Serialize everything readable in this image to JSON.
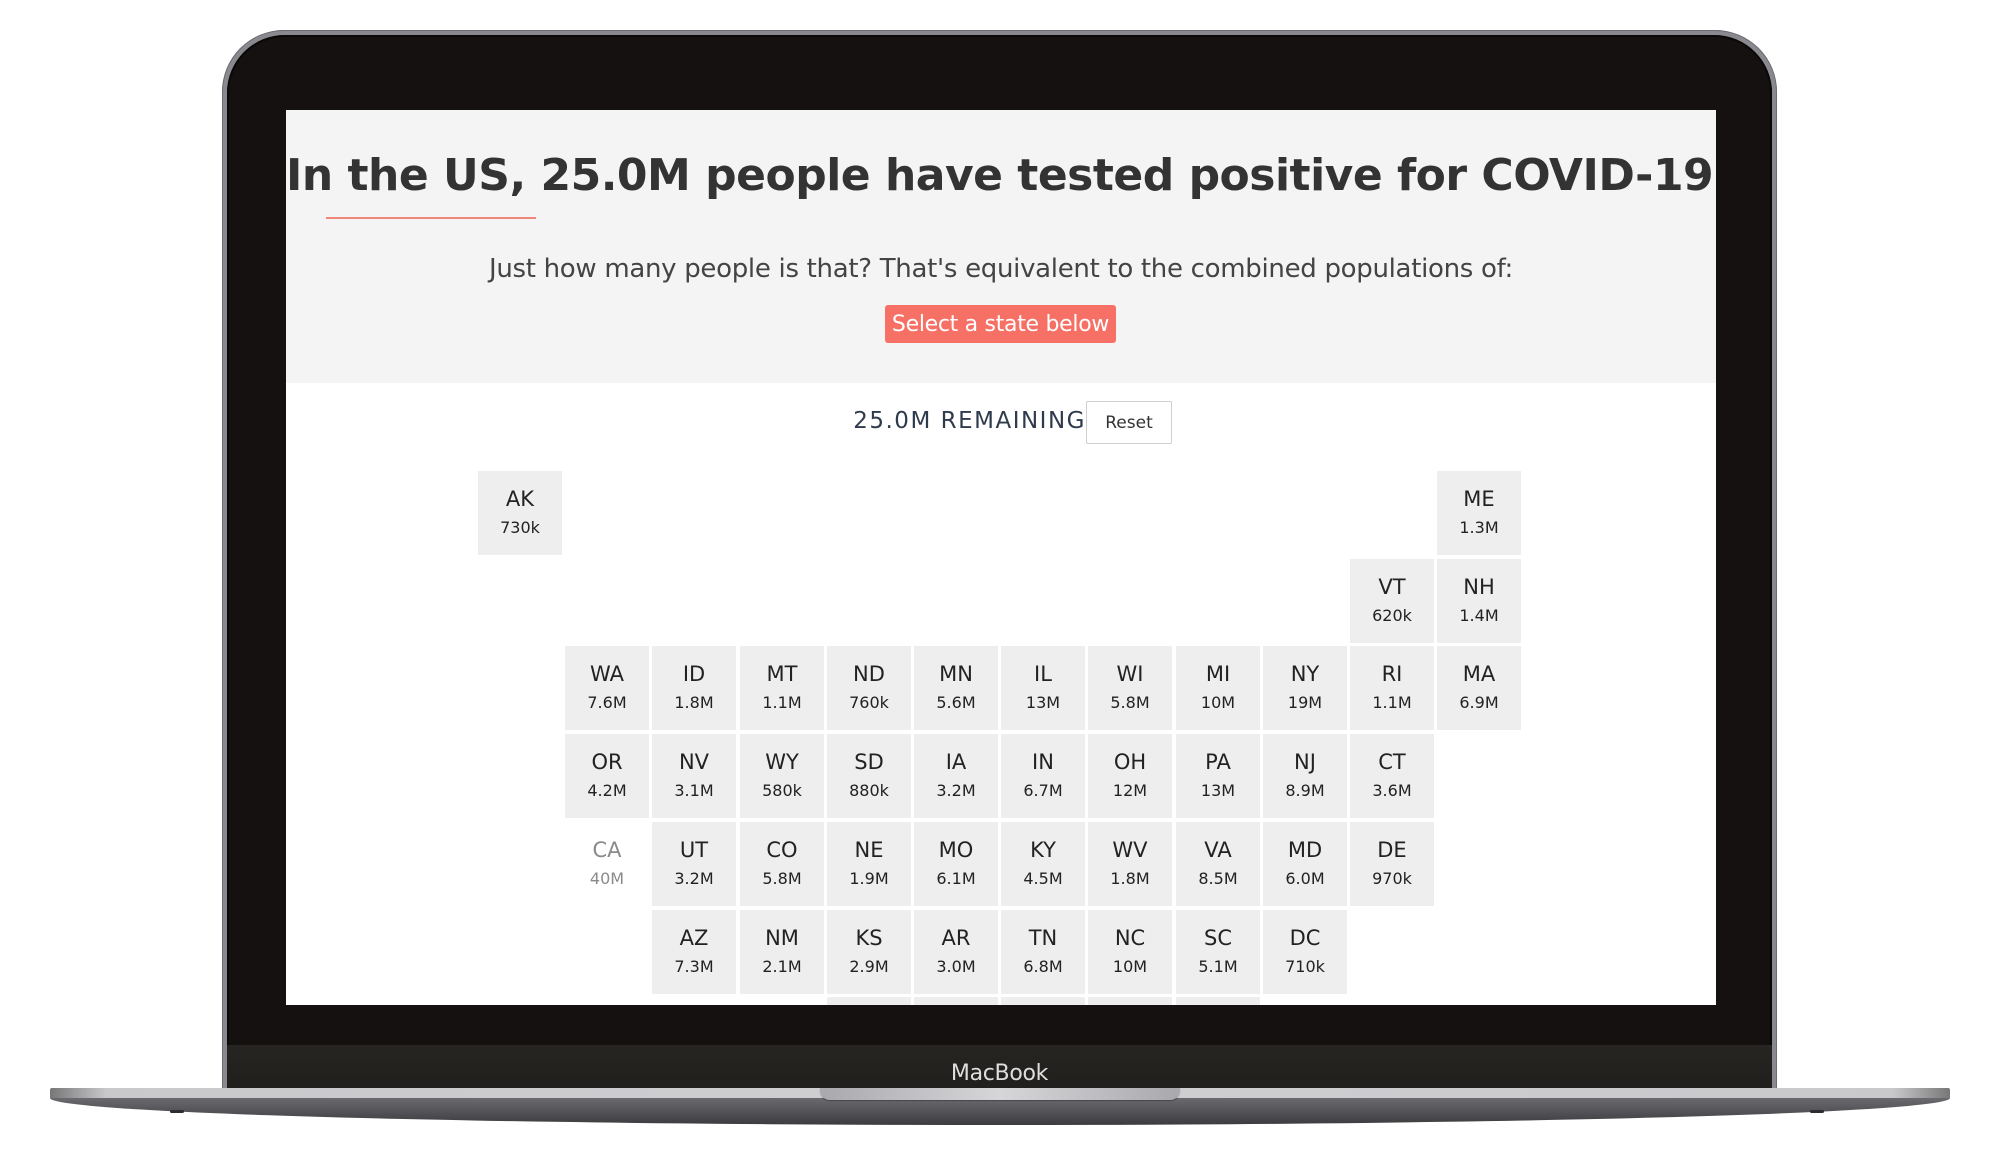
{
  "device": {
    "brand_label": "MacBook"
  },
  "hero": {
    "title": "In the US, 25.0M people have tested positive for COVID-19.",
    "subtitle": "Just how many people is that? That's equivalent to the combined populations of:",
    "cta_label": "Select a state below"
  },
  "controls": {
    "remaining_text": "25.0M REMAINING",
    "reset_label": "Reset"
  },
  "colors": {
    "accent": "#f67066",
    "underline": "#f0857a",
    "tile_bg": "#eeeeee",
    "hero_bg": "#f4f4f4",
    "remaining_text": "#2f3b4d"
  },
  "states": [
    {
      "abbr": "AK",
      "pop": "730k",
      "row": 0,
      "col": 0,
      "enabled": true
    },
    {
      "abbr": "ME",
      "pop": "1.3M",
      "row": 0,
      "col": 11,
      "enabled": true
    },
    {
      "abbr": "VT",
      "pop": "620k",
      "row": 1,
      "col": 10,
      "enabled": true
    },
    {
      "abbr": "NH",
      "pop": "1.4M",
      "row": 1,
      "col": 11,
      "enabled": true
    },
    {
      "abbr": "WA",
      "pop": "7.6M",
      "row": 2,
      "col": 1,
      "enabled": true
    },
    {
      "abbr": "ID",
      "pop": "1.8M",
      "row": 2,
      "col": 2,
      "enabled": true
    },
    {
      "abbr": "MT",
      "pop": "1.1M",
      "row": 2,
      "col": 3,
      "enabled": true
    },
    {
      "abbr": "ND",
      "pop": "760k",
      "row": 2,
      "col": 4,
      "enabled": true
    },
    {
      "abbr": "MN",
      "pop": "5.6M",
      "row": 2,
      "col": 5,
      "enabled": true
    },
    {
      "abbr": "IL",
      "pop": "13M",
      "row": 2,
      "col": 6,
      "enabled": true
    },
    {
      "abbr": "WI",
      "pop": "5.8M",
      "row": 2,
      "col": 7,
      "enabled": true
    },
    {
      "abbr": "MI",
      "pop": "10M",
      "row": 2,
      "col": 8,
      "enabled": true
    },
    {
      "abbr": "NY",
      "pop": "19M",
      "row": 2,
      "col": 9,
      "enabled": true
    },
    {
      "abbr": "RI",
      "pop": "1.1M",
      "row": 2,
      "col": 10,
      "enabled": true
    },
    {
      "abbr": "MA",
      "pop": "6.9M",
      "row": 2,
      "col": 11,
      "enabled": true
    },
    {
      "abbr": "OR",
      "pop": "4.2M",
      "row": 3,
      "col": 1,
      "enabled": true
    },
    {
      "abbr": "NV",
      "pop": "3.1M",
      "row": 3,
      "col": 2,
      "enabled": true
    },
    {
      "abbr": "WY",
      "pop": "580k",
      "row": 3,
      "col": 3,
      "enabled": true
    },
    {
      "abbr": "SD",
      "pop": "880k",
      "row": 3,
      "col": 4,
      "enabled": true
    },
    {
      "abbr": "IA",
      "pop": "3.2M",
      "row": 3,
      "col": 5,
      "enabled": true
    },
    {
      "abbr": "IN",
      "pop": "6.7M",
      "row": 3,
      "col": 6,
      "enabled": true
    },
    {
      "abbr": "OH",
      "pop": "12M",
      "row": 3,
      "col": 7,
      "enabled": true
    },
    {
      "abbr": "PA",
      "pop": "13M",
      "row": 3,
      "col": 8,
      "enabled": true
    },
    {
      "abbr": "NJ",
      "pop": "8.9M",
      "row": 3,
      "col": 9,
      "enabled": true
    },
    {
      "abbr": "CT",
      "pop": "3.6M",
      "row": 3,
      "col": 10,
      "enabled": true
    },
    {
      "abbr": "CA",
      "pop": "40M",
      "row": 4,
      "col": 1,
      "enabled": false
    },
    {
      "abbr": "UT",
      "pop": "3.2M",
      "row": 4,
      "col": 2,
      "enabled": true
    },
    {
      "abbr": "CO",
      "pop": "5.8M",
      "row": 4,
      "col": 3,
      "enabled": true
    },
    {
      "abbr": "NE",
      "pop": "1.9M",
      "row": 4,
      "col": 4,
      "enabled": true
    },
    {
      "abbr": "MO",
      "pop": "6.1M",
      "row": 4,
      "col": 5,
      "enabled": true
    },
    {
      "abbr": "KY",
      "pop": "4.5M",
      "row": 4,
      "col": 6,
      "enabled": true
    },
    {
      "abbr": "WV",
      "pop": "1.8M",
      "row": 4,
      "col": 7,
      "enabled": true
    },
    {
      "abbr": "VA",
      "pop": "8.5M",
      "row": 4,
      "col": 8,
      "enabled": true
    },
    {
      "abbr": "MD",
      "pop": "6.0M",
      "row": 4,
      "col": 9,
      "enabled": true
    },
    {
      "abbr": "DE",
      "pop": "970k",
      "row": 4,
      "col": 10,
      "enabled": true
    },
    {
      "abbr": "AZ",
      "pop": "7.3M",
      "row": 5,
      "col": 2,
      "enabled": true
    },
    {
      "abbr": "NM",
      "pop": "2.1M",
      "row": 5,
      "col": 3,
      "enabled": true
    },
    {
      "abbr": "KS",
      "pop": "2.9M",
      "row": 5,
      "col": 4,
      "enabled": true
    },
    {
      "abbr": "AR",
      "pop": "3.0M",
      "row": 5,
      "col": 5,
      "enabled": true
    },
    {
      "abbr": "TN",
      "pop": "6.8M",
      "row": 5,
      "col": 6,
      "enabled": true
    },
    {
      "abbr": "NC",
      "pop": "10M",
      "row": 5,
      "col": 7,
      "enabled": true
    },
    {
      "abbr": "SC",
      "pop": "5.1M",
      "row": 5,
      "col": 8,
      "enabled": true
    },
    {
      "abbr": "DC",
      "pop": "710k",
      "row": 5,
      "col": 9,
      "enabled": true
    },
    {
      "abbr": "",
      "pop": "",
      "row": 6,
      "col": 4,
      "enabled": true
    },
    {
      "abbr": "",
      "pop": "",
      "row": 6,
      "col": 5,
      "enabled": true
    },
    {
      "abbr": "",
      "pop": "",
      "row": 6,
      "col": 6,
      "enabled": true
    },
    {
      "abbr": "",
      "pop": "",
      "row": 6,
      "col": 7,
      "enabled": true
    },
    {
      "abbr": "",
      "pop": "",
      "row": 6,
      "col": 8,
      "enabled": true
    }
  ]
}
